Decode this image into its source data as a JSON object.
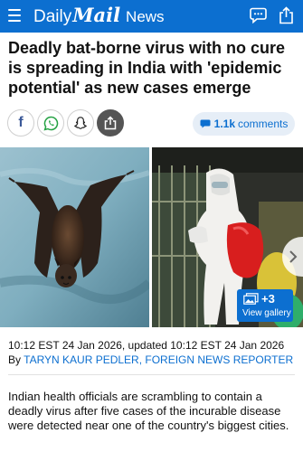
{
  "header": {
    "logo_daily": "Daily",
    "logo_mail": "Mail",
    "logo_news": "News",
    "bg_color": "#0c6fd0",
    "icons": [
      "menu-icon",
      "comment-icon",
      "share-icon"
    ]
  },
  "article": {
    "headline": "Deadly bat-borne virus with no cure is spreading in India with 'epidemic potential' as new cases emerge",
    "timestamp": "10:12 EST 24 Jan 2026, updated 10:12 EST 24 Jan 2026",
    "by_prefix": "By ",
    "author": "TARYN KAUR PEDLER, FOREIGN NEWS REPORTER",
    "body": "Indian health officials are scrambling to contain a deadly virus after five cases of the incurable disease were detected near one of the country's biggest cities."
  },
  "share": {
    "facebook_glyph": "f",
    "comments_count": "1.1k",
    "comments_label": "comments",
    "buttons": [
      "facebook-icon",
      "whatsapp-icon",
      "snapchat-icon",
      "share-icon"
    ]
  },
  "gallery": {
    "count": "+3",
    "label": "View gallery"
  }
}
